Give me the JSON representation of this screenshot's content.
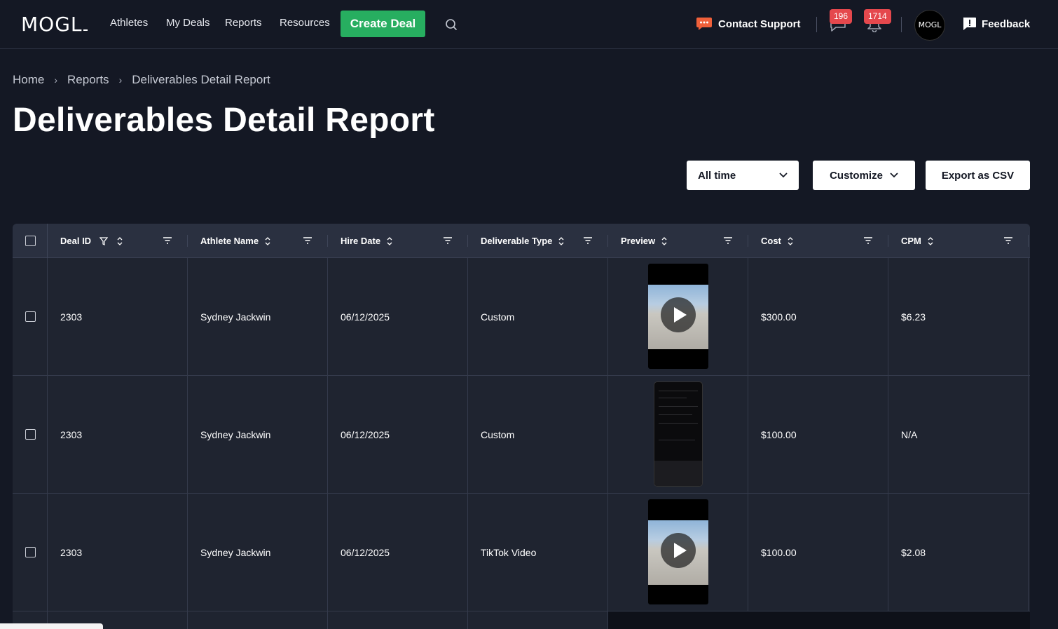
{
  "nav": {
    "logo": "MOGL",
    "links": [
      "Athletes",
      "My Deals",
      "Reports",
      "Resources"
    ],
    "create_deal": "Create Deal",
    "contact_support": "Contact Support",
    "messages_count": "196",
    "notifications_count": "1714",
    "avatar_text": "MOGL",
    "feedback": "Feedback",
    "icons": [
      "search-icon",
      "chat-bubble-icon",
      "message-icon",
      "bell-icon",
      "feedback-icon"
    ]
  },
  "breadcrumb": [
    "Home",
    "Reports",
    "Deliverables Detail Report"
  ],
  "page_title": "Deliverables Detail Report",
  "controls": {
    "time_filter": "All time",
    "customize": "Customize",
    "export": "Export as CSV"
  },
  "table": {
    "columns": [
      "Deal ID",
      "Athlete Name",
      "Hire Date",
      "Deliverable Type",
      "Preview",
      "Cost",
      "CPM"
    ],
    "rows": [
      {
        "deal_id": "2303",
        "athlete": "Sydney Jackwin",
        "hire_date": "06/12/2025",
        "type": "Custom",
        "preview": "video",
        "cost": "$300.00",
        "cpm": "$6.23"
      },
      {
        "deal_id": "2303",
        "athlete": "Sydney Jackwin",
        "hire_date": "06/12/2025",
        "type": "Custom",
        "preview": "screenshot",
        "cost": "$100.00",
        "cpm": "N/A"
      },
      {
        "deal_id": "2303",
        "athlete": "Sydney Jackwin",
        "hire_date": "06/12/2025",
        "type": "TikTok Video",
        "preview": "video",
        "cost": "$100.00",
        "cpm": "$2.08"
      }
    ]
  },
  "colors": {
    "background": "#141824",
    "table_header": "#2a3040",
    "table_body": "#1f2430",
    "accent_green": "#27ae60",
    "badge_red": "#e5484d"
  }
}
